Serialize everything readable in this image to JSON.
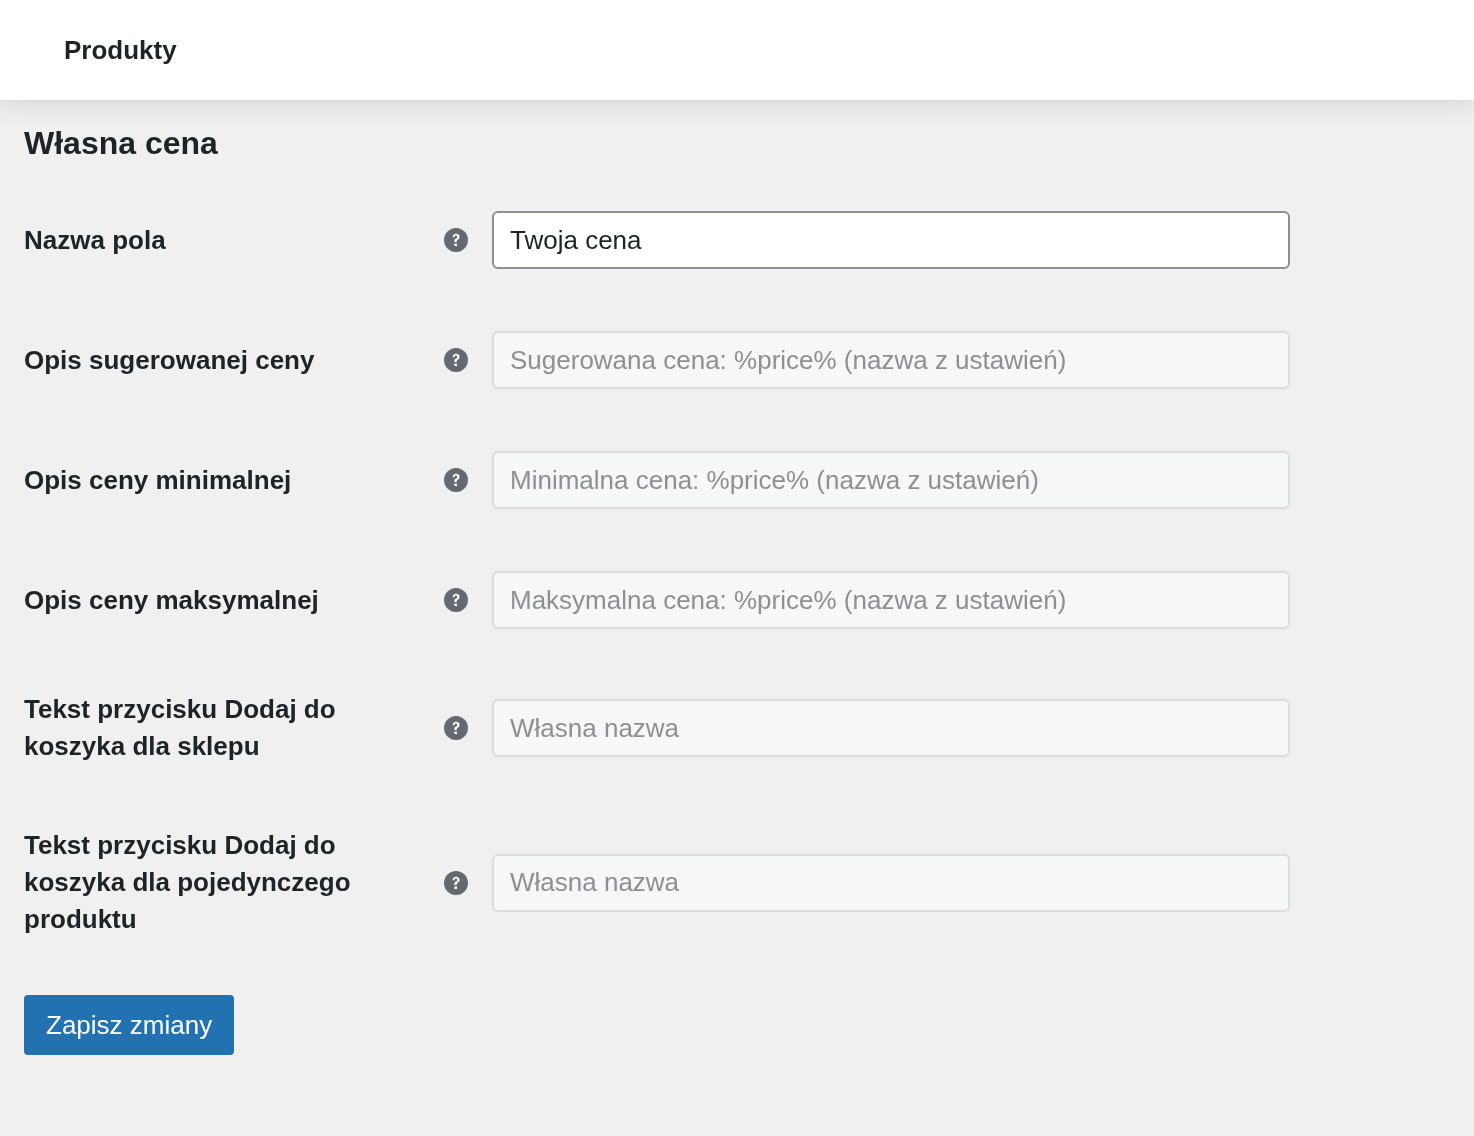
{
  "header": {
    "title": "Produkty"
  },
  "section": {
    "title": "Własna cena"
  },
  "fields": [
    {
      "label": "Nazwa pola",
      "value": "Twoja cena"
    },
    {
      "label": "Opis sugerowanej ceny",
      "placeholder": "Sugerowana cena: %price% (nazwa z ustawień)"
    },
    {
      "label": "Opis ceny minimalnej",
      "placeholder": "Minimalna cena: %price% (nazwa z ustawień)"
    },
    {
      "label": "Opis ceny maksymalnej",
      "placeholder": "Maksymalna cena: %price% (nazwa z ustawień)"
    },
    {
      "label": "Tekst przycisku Dodaj do koszyka dla sklepu",
      "placeholder": "Własna nazwa"
    },
    {
      "label": "Tekst przycisku Dodaj do koszyka dla pojedynczego produktu",
      "placeholder": "Własna nazwa"
    }
  ],
  "save_button": "Zapisz zmiany"
}
